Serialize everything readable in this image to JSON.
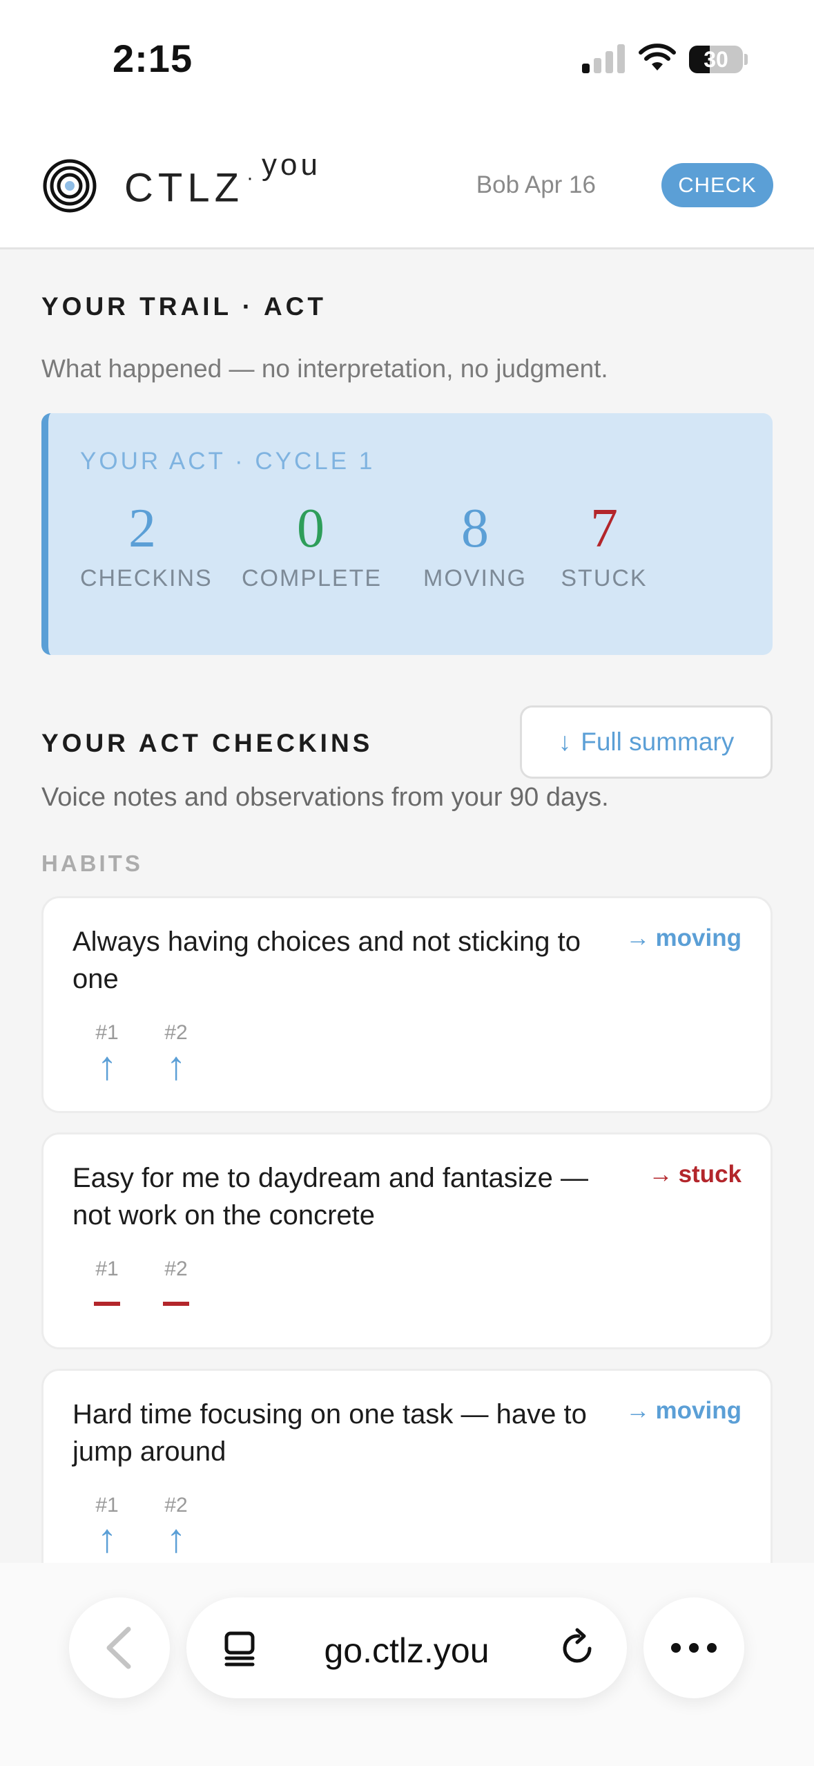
{
  "status_bar": {
    "time": "2:15",
    "battery": "30"
  },
  "header": {
    "brand_main": "CTLZ",
    "brand_dot": "·",
    "brand_sup": "you",
    "user_date": "Bob Apr 16",
    "check_label": "CHECK"
  },
  "trail": {
    "title": "YOUR TRAIL · ACT",
    "subtitle": "What happened — no interpretation, no judgment."
  },
  "stats": {
    "label": "YOUR ACT · CYCLE 1",
    "items": [
      {
        "value": "2",
        "label": "CHECKINS",
        "color": "#5b9fd6"
      },
      {
        "value": "0",
        "label": "COMPLETE",
        "color": "#2e9e5a"
      },
      {
        "value": "8",
        "label": "MOVING",
        "color": "#5b9fd6"
      },
      {
        "value": "7",
        "label": "STUCK",
        "color": "#b3262b"
      }
    ]
  },
  "checkins": {
    "title": "YOUR ACT CHECKINS",
    "subtitle": "Voice notes and observations from your 90 days.",
    "full_summary_arrow": "↓",
    "full_summary_label": "Full summary",
    "category": "HABITS",
    "cards": [
      {
        "text": "Always having choices and not sticking to one",
        "arrow": "→",
        "status": "moving",
        "marks": [
          {
            "n": "#1",
            "sym": "↑"
          },
          {
            "n": "#2",
            "sym": "↑"
          }
        ]
      },
      {
        "text": "Easy for me to daydream and fantasize — not work on the concrete",
        "arrow": "→",
        "status": "stuck",
        "marks": [
          {
            "n": "#1",
            "sym": "—"
          },
          {
            "n": "#2",
            "sym": "—"
          }
        ]
      },
      {
        "text": "Hard time focusing on one task — have to jump around",
        "arrow": "→",
        "status": "moving",
        "marks": [
          {
            "n": "#1",
            "sym": "↑"
          },
          {
            "n": "#2",
            "sym": "↑"
          }
        ]
      }
    ]
  },
  "browser": {
    "url": "go.ctlz.you"
  },
  "colors": {
    "accent": "#5b9fd6",
    "stuck": "#b3262b",
    "complete": "#2e9e5a",
    "card_bg": "#d4e6f6"
  }
}
